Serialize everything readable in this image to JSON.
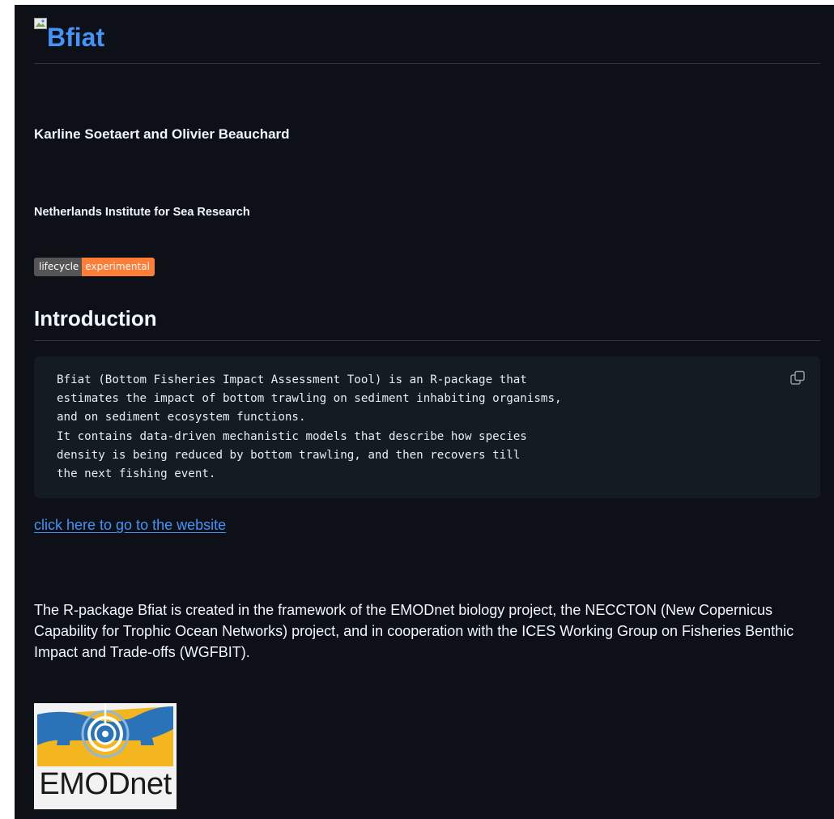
{
  "readme": {
    "title": "Bfiat",
    "authors": "Karline Soetaert and Olivier Beauchard",
    "institute": "Netherlands Institute for Sea Research",
    "badge": {
      "label": "lifecycle",
      "status": "experimental",
      "label_color": "#555555",
      "status_color": "#fe7d37"
    },
    "intro_heading": "Introduction",
    "code_lines": [
      "Bfiat (Bottom Fisheries Impact Assessment Tool) is an R-package that",
      "estimates the impact of bottom trawling on sediment inhabiting organisms,",
      "and on sediment ecosystem functions.",
      "It contains data-driven mechanistic models that describe how species",
      "density is being reduced by bottom trawling, and then recovers till",
      "the next fishing event."
    ],
    "website_link": "click here to go to the website",
    "paragraph": "The R-package Bfiat is created in the framework of the EMODnet biology project, the NECCTON (New Copernicus Capability for Trophic Ocean Networks) project, and in cooperation with the ICES Working Group on Fisheries Benthic Impact and Trade-offs (WGFBIT).",
    "logo_text": "EMODnet"
  },
  "icons": {
    "copy": "copy-icon",
    "broken_image": "broken-image-icon"
  },
  "colors": {
    "background": "#0d1117",
    "text": "#f0f6fc",
    "link": "#4493f8",
    "code_bg": "#151b23",
    "border": "#30363d"
  }
}
